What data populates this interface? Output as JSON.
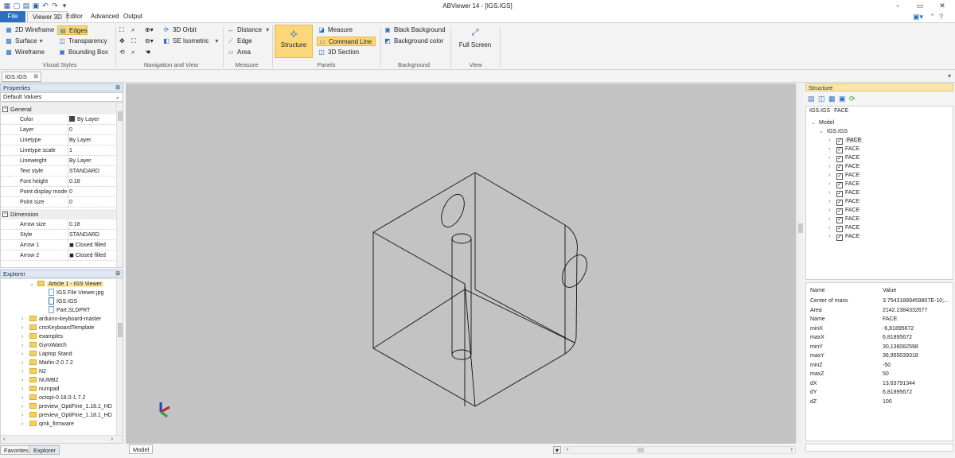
{
  "window": {
    "title": "ABViewer 14 - [IGS.IGS]"
  },
  "menu": {
    "file": "File",
    "tabs": [
      "Viewer 3D",
      "Editor",
      "Advanced",
      "Output"
    ]
  },
  "ribbon": {
    "visual_styles": {
      "label": "Visual Styles",
      "wireframe_2d": "2D Wireframe",
      "surface": "Surface",
      "wireframe": "Wireframe",
      "edges": "Edges",
      "transparency": "Transparency",
      "bounding_box": "Bounding Box"
    },
    "navigation": {
      "label": "Navigation and View",
      "orbit_3d": "3D Orbit",
      "se_isometric": "SE Isometric"
    },
    "measure": {
      "label": "Measure",
      "distance": "Distance",
      "edge": "Edge",
      "area": "Area"
    },
    "panels": {
      "label": "Panels",
      "structure": "Structure",
      "measure": "Measure",
      "command_line": "Command Line",
      "section_3d": "3D Section"
    },
    "background": {
      "label": "Background",
      "black": "Black Background",
      "color": "Background color"
    },
    "view": {
      "label": "View",
      "full_screen": "Full Screen"
    }
  },
  "doc_tab": "IGS.IGS",
  "properties": {
    "title": "Properties",
    "dropdown": "Default Values",
    "general": "General",
    "rows": [
      {
        "k": "Color",
        "v": "By Layer"
      },
      {
        "k": "Layer",
        "v": "0"
      },
      {
        "k": "Linetype",
        "v": "By Layer"
      },
      {
        "k": "Linetype scale",
        "v": "1"
      },
      {
        "k": "Lineweight",
        "v": "By Layer"
      },
      {
        "k": "Text style",
        "v": "STANDARD"
      },
      {
        "k": "Font height",
        "v": "0.18"
      },
      {
        "k": "Point display mode",
        "v": "0"
      },
      {
        "k": "Point size",
        "v": "0"
      }
    ],
    "dimension": "Dimension",
    "dim_rows": [
      {
        "k": "Arrow size",
        "v": "0.18"
      },
      {
        "k": "Style",
        "v": "STANDARD"
      },
      {
        "k": "Arrow 1",
        "v": "Closed filled"
      },
      {
        "k": "Arrow 2",
        "v": "Closed filled"
      }
    ]
  },
  "explorer": {
    "title": "Explorer",
    "open_folder": "Article 1 - IGS Viewer",
    "files": [
      "IGS File Viewer.jpg",
      "IGS.IGS",
      "Part.SLDPRT"
    ],
    "folders": [
      "arduino-keyboard-master",
      "cncKeyboardTemplate",
      "examples",
      "GyroWatch",
      "Laptop Stand",
      "Marlin-2.0.7.2",
      "N2",
      "NUMB2",
      "numpad",
      "octopi-0.18.0-1.7.2",
      "preview_OptiFine_1.18.1_HD",
      "preview_OptiFine_1.18.1_HD",
      "qmk_firmware"
    ],
    "tabs": [
      "Favorites",
      "Explorer"
    ]
  },
  "viewport": {
    "tab": "Model",
    "background": "#c3c3c3"
  },
  "structure": {
    "title": "Structure",
    "path": [
      "IGS.IGS",
      "FACE"
    ],
    "model": "Model",
    "file": "IGS.IGS",
    "faces": [
      "FACE",
      "FACE",
      "FACE",
      "FACE",
      "FACE",
      "FACE",
      "FACE",
      "FACE",
      "FACE",
      "FACE",
      "FACE",
      "FACE"
    ]
  },
  "values": {
    "header": [
      "Name",
      "Value"
    ],
    "rows": [
      {
        "k": "Center of mass",
        "v": "3.75431889459807E-10;..."
      },
      {
        "k": "Area",
        "v": "2142.2384332677"
      },
      {
        "k": "Name",
        "v": "FACE"
      },
      {
        "k": "minX",
        "v": "-6,81895672"
      },
      {
        "k": "maxX",
        "v": "6,81895672"
      },
      {
        "k": "minY",
        "v": "30,136082598"
      },
      {
        "k": "maxY",
        "v": "36,955039318"
      },
      {
        "k": "minZ",
        "v": "-50"
      },
      {
        "k": "maxZ",
        "v": "50"
      },
      {
        "k": "dX",
        "v": "13,63791344"
      },
      {
        "k": "dY",
        "v": "6,81895672"
      },
      {
        "k": "dZ",
        "v": "100"
      }
    ]
  }
}
